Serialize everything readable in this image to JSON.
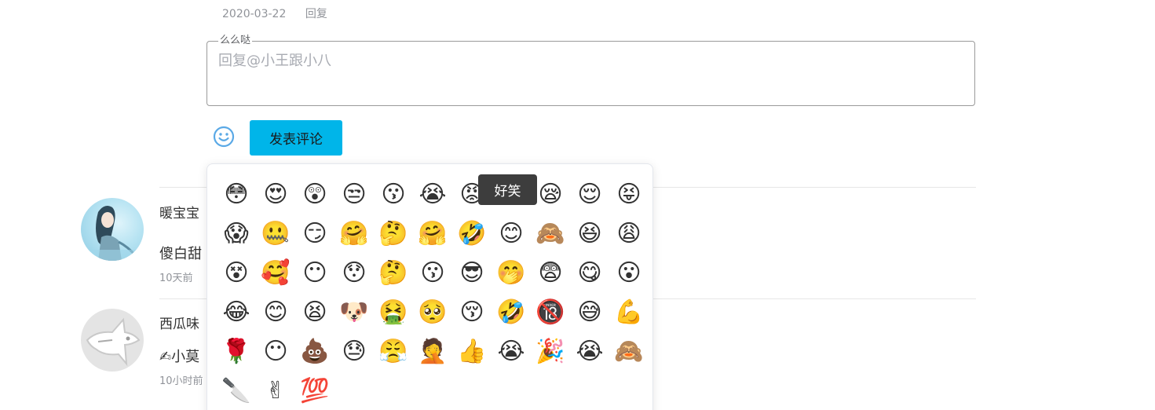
{
  "top_comment": {
    "date": "2020-03-22",
    "reply_label": "回复"
  },
  "reply_box": {
    "legend": "么么哒",
    "placeholder": "回复@小王跟小八"
  },
  "actions": {
    "emoji_icon": "smile-icon",
    "post_label": "发表评论",
    "accent_color": "#00b5e9"
  },
  "comments": [
    {
      "name": "暖宝宝",
      "text": "傻白甜",
      "time": "10天前",
      "avatar": "anime-girl-avatar"
    },
    {
      "name": "西瓜味",
      "text": "✍小莫",
      "time": "10小时前",
      "avatar": "default-cat-avatar"
    }
  ],
  "emoji_panel": {
    "tooltip": "好笑",
    "emojis": [
      "😳",
      "😍",
      "😲",
      "😒",
      "😗",
      "😭",
      "😡",
      "😂",
      "😪",
      "😌",
      "😝",
      "😱",
      "🤐",
      "😏",
      "🤗",
      "🤔",
      "🤗",
      "🤣",
      "😊",
      "🙈",
      "😆",
      "😩",
      "😵",
      "🥰",
      "😶",
      "😯",
      "🤔",
      "😗",
      "😎",
      "🤭",
      "😨",
      "😋",
      "😮",
      "😂",
      "😊",
      "😫",
      "🐶",
      "🤮",
      "🥺",
      "😚",
      "🤣",
      "🔞",
      "😅",
      "💪",
      "🌹",
      "😶",
      "💩",
      "😓",
      "😤",
      "🤦",
      "👍",
      "😭",
      "🎉",
      "😭",
      "🙈",
      "🔪",
      "✌",
      "💯"
    ]
  }
}
